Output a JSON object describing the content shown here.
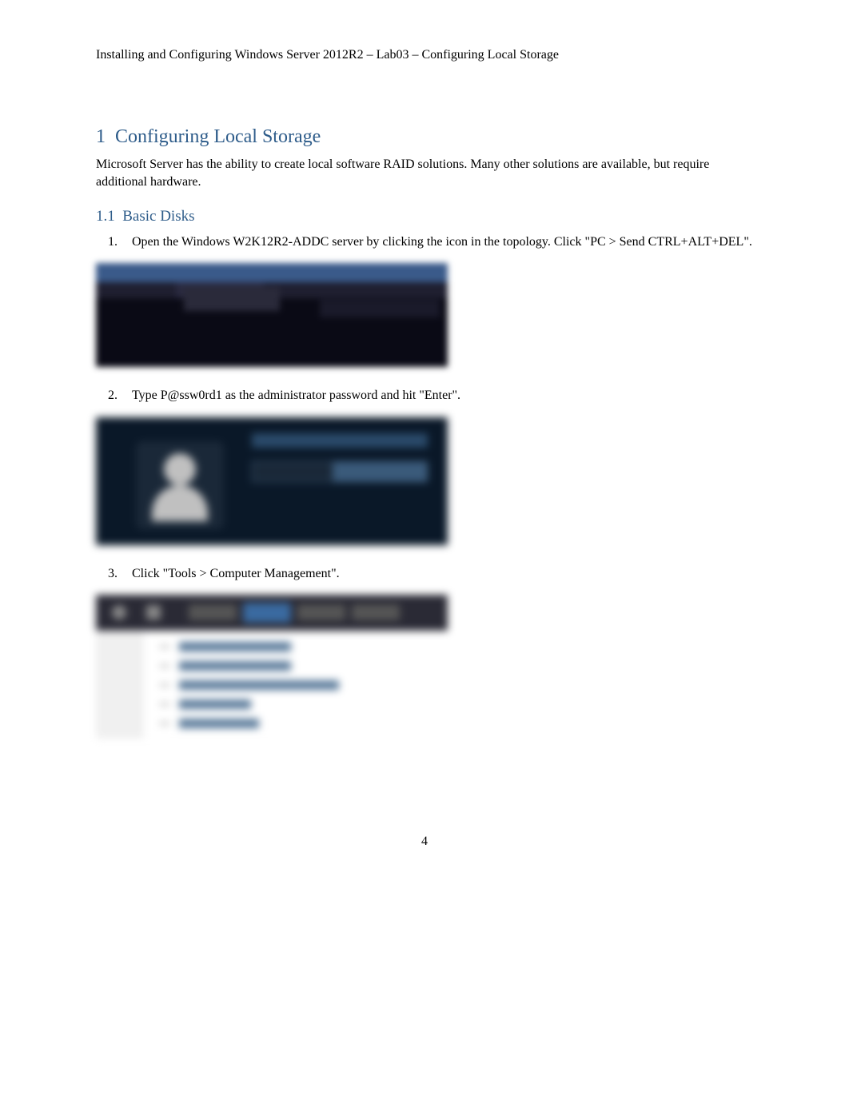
{
  "header": {
    "text": "Installing and Configuring Windows Server 2012R2 – Lab03 – Configuring Local Storage"
  },
  "section1": {
    "number": "1",
    "title": "Configuring Local Storage",
    "intro": "Microsoft Server has the ability to create local software RAID solutions. Many other solutions are available, but require additional hardware."
  },
  "section1_1": {
    "number": "1.1",
    "title": "Basic Disks",
    "steps": [
      {
        "number": "1.",
        "text": "Open the Windows W2K12R2-ADDC server by clicking the icon in the topology. Click \"PC > Send CTRL+ALT+DEL\"."
      },
      {
        "number": "2.",
        "text": "Type P@ssw0rd1  as the administrator password and hit \"Enter\"."
      },
      {
        "number": "3.",
        "text": "Click \"Tools > Computer Management\"."
      }
    ]
  },
  "page": {
    "number": "4"
  }
}
